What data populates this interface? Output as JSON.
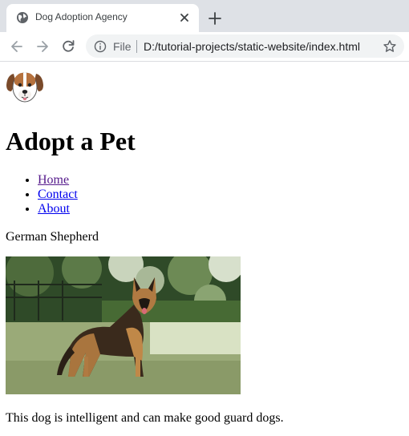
{
  "browser": {
    "tab_title": "Dog Adoption Agency",
    "scheme_label": "File",
    "url": "D:/tutorial-projects/static-website/index.html"
  },
  "page": {
    "title": "Adopt a Pet",
    "nav": [
      {
        "label": "Home",
        "state": "visited"
      },
      {
        "label": "Contact",
        "state": "unvisited"
      },
      {
        "label": "About",
        "state": "unvisited"
      }
    ],
    "breed_name": "German Shepherd",
    "description": "This dog is intelligent and can make good guard dogs."
  },
  "colors": {
    "link": "#0000ee",
    "visited_link": "#551a8b",
    "tabstrip_bg": "#dee1e6",
    "omnibox_bg": "#f1f3f4"
  },
  "icons": [
    "globe-icon",
    "close-icon",
    "plus-icon",
    "back-arrow-icon",
    "forward-arrow-icon",
    "reload-icon",
    "info-icon",
    "star-icon",
    "dog-face-icon"
  ]
}
